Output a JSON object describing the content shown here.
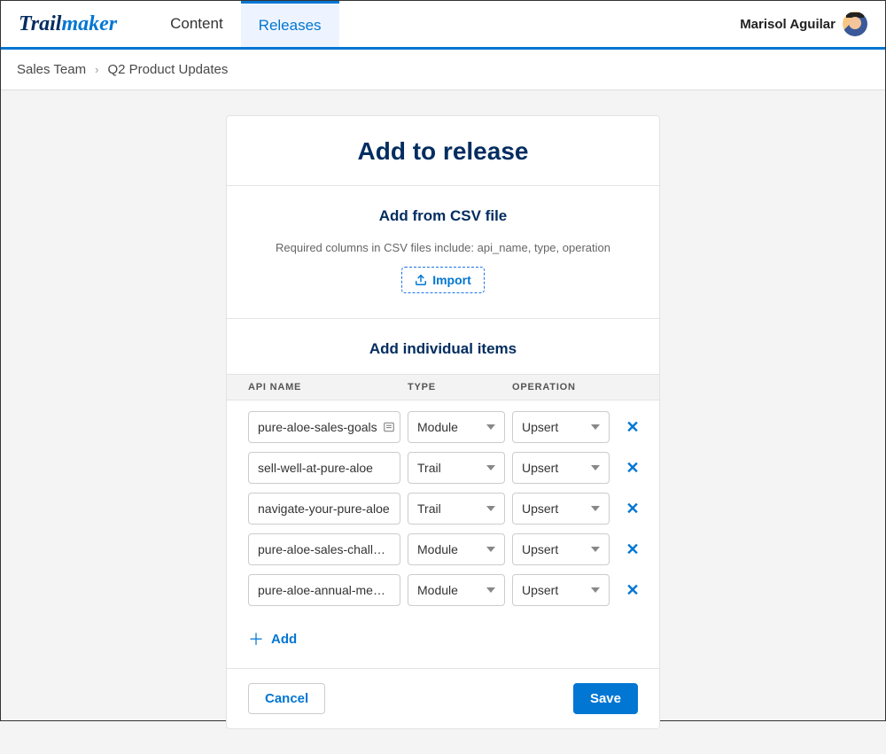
{
  "brand": {
    "part1": "Trail",
    "part2": "maker"
  },
  "nav": {
    "content": "Content",
    "releases": "Releases"
  },
  "user": {
    "name": "Marisol Aguilar"
  },
  "breadcrumb": {
    "item1": "Sales Team",
    "item2": "Q2 Product Updates"
  },
  "card": {
    "title": "Add to release",
    "csv": {
      "heading": "Add from CSV file",
      "helper": "Required columns in CSV files include: api_name, type, operation",
      "import_label": "Import"
    },
    "individual": {
      "heading": "Add individual items",
      "columns": {
        "api": "API NAME",
        "type": "TYPE",
        "operation": "OPERATION"
      },
      "rows": [
        {
          "api": "pure-aloe-sales-goals",
          "type": "Module",
          "operation": "Upsert"
        },
        {
          "api": "sell-well-at-pure-aloe",
          "type": "Trail",
          "operation": "Upsert"
        },
        {
          "api": "navigate-your-pure-aloe",
          "type": "Trail",
          "operation": "Upsert"
        },
        {
          "api": "pure-aloe-sales-challenge",
          "type": "Module",
          "operation": "Upsert"
        },
        {
          "api": "pure-aloe-annual-meeting",
          "type": "Module",
          "operation": "Upsert"
        }
      ],
      "add_label": "Add"
    },
    "actions": {
      "cancel": "Cancel",
      "save": "Save"
    }
  }
}
